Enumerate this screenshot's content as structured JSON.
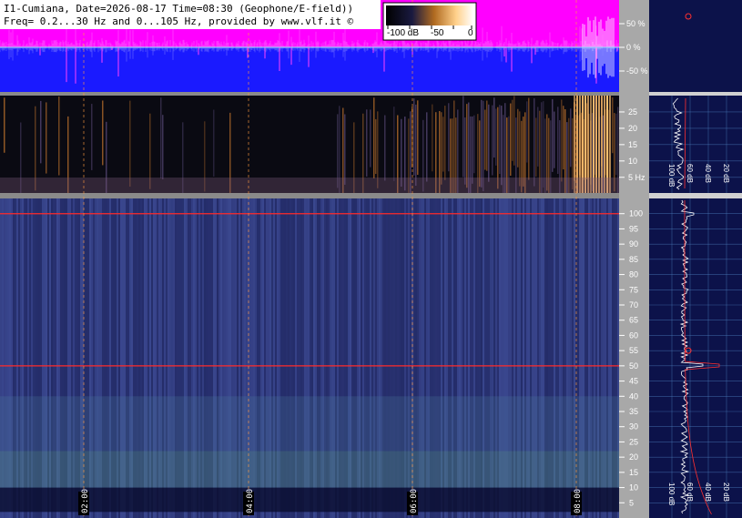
{
  "header": {
    "line1": "I1-Cumiana, Date=2026-08-17 Time=08:30 (Geophone/E-field))",
    "line2": "Freq= 0.2...30 Hz and 0...105 Hz, provided by www.vlf.it ©"
  },
  "colorbar": {
    "labels": [
      "-100 dB",
      "-50",
      "0"
    ]
  },
  "colors": {
    "amplitude_bg": "#1a1aff",
    "amplitude_trace": "#ff00ff",
    "spectrogram_bg": "#2c3576",
    "right_panel_bg": "#0c124a",
    "axis_bg": "#a8a8a8",
    "marker_line": "#ff2a2a"
  },
  "chart_data": [
    {
      "type": "line",
      "panel": "amplitude",
      "y_ticks": [
        "50 %",
        "0 %",
        "-50 %"
      ],
      "ylim": [
        -100,
        100
      ]
    },
    {
      "type": "heatmap",
      "panel": "low-frequency spectrogram",
      "y_ticks": [
        "25",
        "20",
        "15",
        "10",
        "5 Hz"
      ],
      "ylim": [
        0.2,
        30
      ]
    },
    {
      "type": "heatmap",
      "panel": "main spectrogram",
      "x_ticks": [
        "02:00",
        "04:00",
        "06:00",
        "08:00"
      ],
      "y_ticks": [
        "100",
        "95",
        "90",
        "85",
        "80",
        "75",
        "70",
        "65",
        "60",
        "55",
        "50",
        "45",
        "40",
        "35",
        "30",
        "25",
        "20",
        "15",
        "10",
        "5"
      ],
      "ylim": [
        0,
        105
      ],
      "horizontal_lines_hz": [
        100,
        50
      ]
    },
    {
      "type": "line",
      "panel": "low-frequency average spectrum",
      "x_ticks": [
        "100 dB",
        "60 dB",
        "40 dB",
        "20 dB"
      ]
    },
    {
      "type": "line",
      "panel": "main average spectrum",
      "x_ticks": [
        "100 dB",
        "60 dB",
        "40 dB",
        "20 dB"
      ]
    }
  ]
}
